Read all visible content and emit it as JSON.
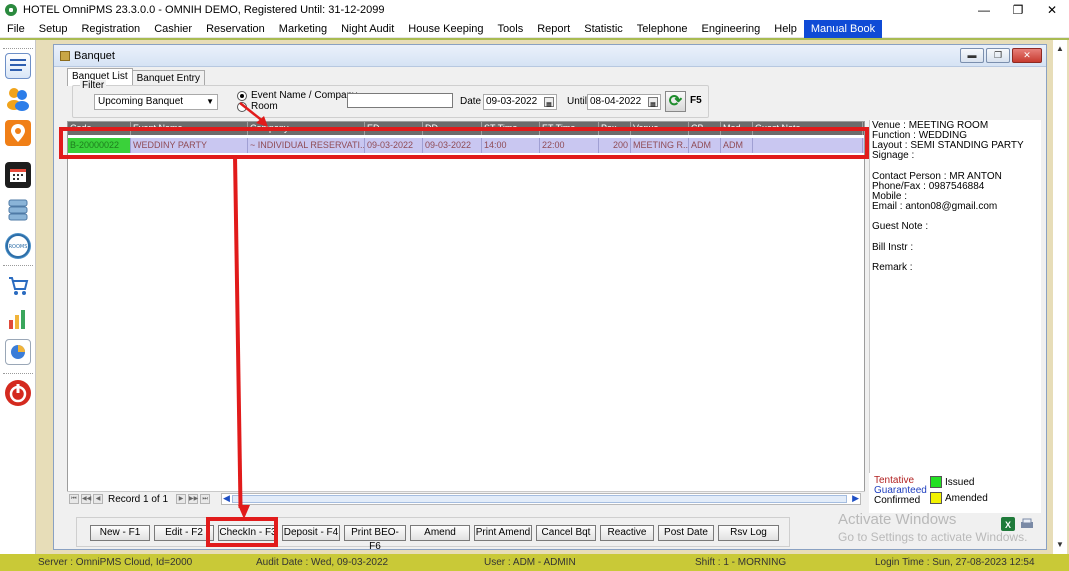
{
  "window": {
    "title": "HOTEL OmniPMS 23.3.0.0 - OMNIH DEMO, Registered Until: 31-12-2099",
    "controls": [
      "—",
      "❐",
      "✕"
    ]
  },
  "menu": [
    "File",
    "Setup",
    "Registration",
    "Cashier",
    "Reservation",
    "Marketing",
    "Night Audit",
    "House Keeping",
    "Tools",
    "Report",
    "Statistic",
    "Telephone",
    "Engineering",
    "Help",
    "Manual Book"
  ],
  "toolbar_icons": [
    "list-icon",
    "guests-icon",
    "location-icon",
    "calendar-icon",
    "server-icon",
    "rooms-icon",
    "cart-icon",
    "chart-icon",
    "report-icon",
    "power-icon"
  ],
  "toolbar_rooms_label": "ROOMS",
  "mdi": {
    "title": "Banquet",
    "tabs": [
      "Banquet List",
      "Banquet Entry"
    ]
  },
  "filter": {
    "legend": "Filter",
    "selected": "Upcoming Banquet",
    "radio_event": "Event Name / Company",
    "radio_room": "Room",
    "search_value": "",
    "date_label": "Date",
    "date_value": "09-03-2022",
    "until_label": "Until",
    "until_value": "08-04-2022",
    "refresh_key": "F5"
  },
  "grid": {
    "columns": [
      "Code",
      "Event Name",
      "Company",
      "ED",
      "DD",
      "ST Time",
      "ET Time",
      "Pax",
      "Venue",
      "CB",
      "Mod",
      "Guest Note"
    ],
    "rows": [
      {
        "code": "B-20000022",
        "event": "WEDDINY PARTY",
        "company": "~ INDIVIDUAL RESERVATI...",
        "ed": "09-03-2022",
        "dd": "09-03-2022",
        "st": "14:00",
        "et": "22:00",
        "pax": "200",
        "venue": "MEETING R...",
        "cb": "ADM",
        "mod": "ADM",
        "note": ""
      }
    ],
    "record_label": "Record 1 of 1",
    "nav": [
      "⏮",
      "◀◀",
      "◀",
      "▶",
      "▶▶",
      "⏭"
    ]
  },
  "info": {
    "venue": "Venue : MEETING ROOM",
    "function": "Function : WEDDING",
    "layout": "Layout : SEMI STANDING PARTY",
    "signage": "Signage :",
    "contact": "Contact Person : MR ANTON",
    "phone": "Phone/Fax : 0987546884",
    "mobile": "Mobile :",
    "email": "Email : anton08@gmail.com",
    "guest_note": "Guest Note :",
    "bill_instr": "Bill Instr :",
    "remark": "Remark :"
  },
  "legend": {
    "tentative": "Tentative",
    "guaranteed": "Guaranteed",
    "confirmed": "Confirmed",
    "issued": "Issued",
    "amended": "Amended",
    "colors": {
      "tentative": "#b22222",
      "guaranteed": "#1f3fbf",
      "confirmed": "#000000",
      "issued": "#22e022",
      "amended": "#f2f200"
    }
  },
  "buttons": [
    "New - F1",
    "Edit - F2",
    "CheckIn - F3",
    "Deposit - F4",
    "Print BEO- F6",
    "Amend",
    "Print Amend",
    "Cancel Bqt",
    "Reactive",
    "Post Date",
    "Rsv Log"
  ],
  "watermark": {
    "line1": "Activate Windows",
    "line2": "Go to Settings to activate Windows."
  },
  "status": {
    "server": "Server : OmniPMS Cloud, Id=2000",
    "audit": "Audit Date : Wed, 09-03-2022",
    "user": "User : ADM - ADMIN",
    "shift": "Shift : 1 - MORNING",
    "login": "Login Time : Sun, 27-08-2023 12:54"
  }
}
